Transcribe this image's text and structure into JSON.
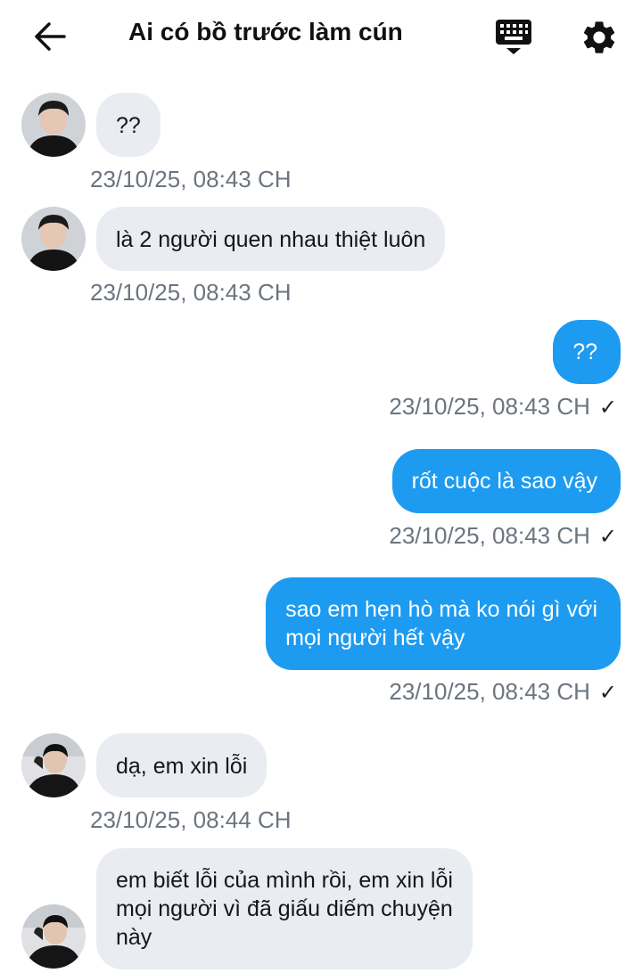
{
  "header": {
    "title": "Ai có bồ trước làm cún",
    "back_icon": "arrow-left-icon",
    "keyboard_icon": "keyboard-icon",
    "settings_icon": "gear-icon"
  },
  "colors": {
    "incoming_bubble": "#e9ecf1",
    "outgoing_bubble": "#1d9bf0",
    "timestamp": "#6b7580"
  },
  "messages": [
    {
      "direction": "in",
      "text": "??",
      "time": "23/10/25, 08:43 CH"
    },
    {
      "direction": "in",
      "text": "là 2 người quen nhau thiệt luôn",
      "time": "23/10/25, 08:43 CH"
    },
    {
      "direction": "out",
      "text": "??",
      "time": "23/10/25, 08:43 CH",
      "status": "✓"
    },
    {
      "direction": "out",
      "text": "rốt cuộc là sao vậy",
      "time": "23/10/25, 08:43 CH",
      "status": "✓"
    },
    {
      "direction": "out",
      "lines": [
        "sao em hẹn hò mà ko nói gì với",
        "mọi người hết vậy"
      ],
      "time": "23/10/25, 08:43 CH",
      "status": "✓"
    },
    {
      "direction": "in",
      "text": "dạ, em xin lỗi",
      "time": "23/10/25, 08:44 CH"
    },
    {
      "direction": "in",
      "lines": [
        "em biết lỗi của mình rồi, em xin lỗi",
        "mọi người vì đã giấu diếm chuyện",
        "này"
      ]
    }
  ]
}
